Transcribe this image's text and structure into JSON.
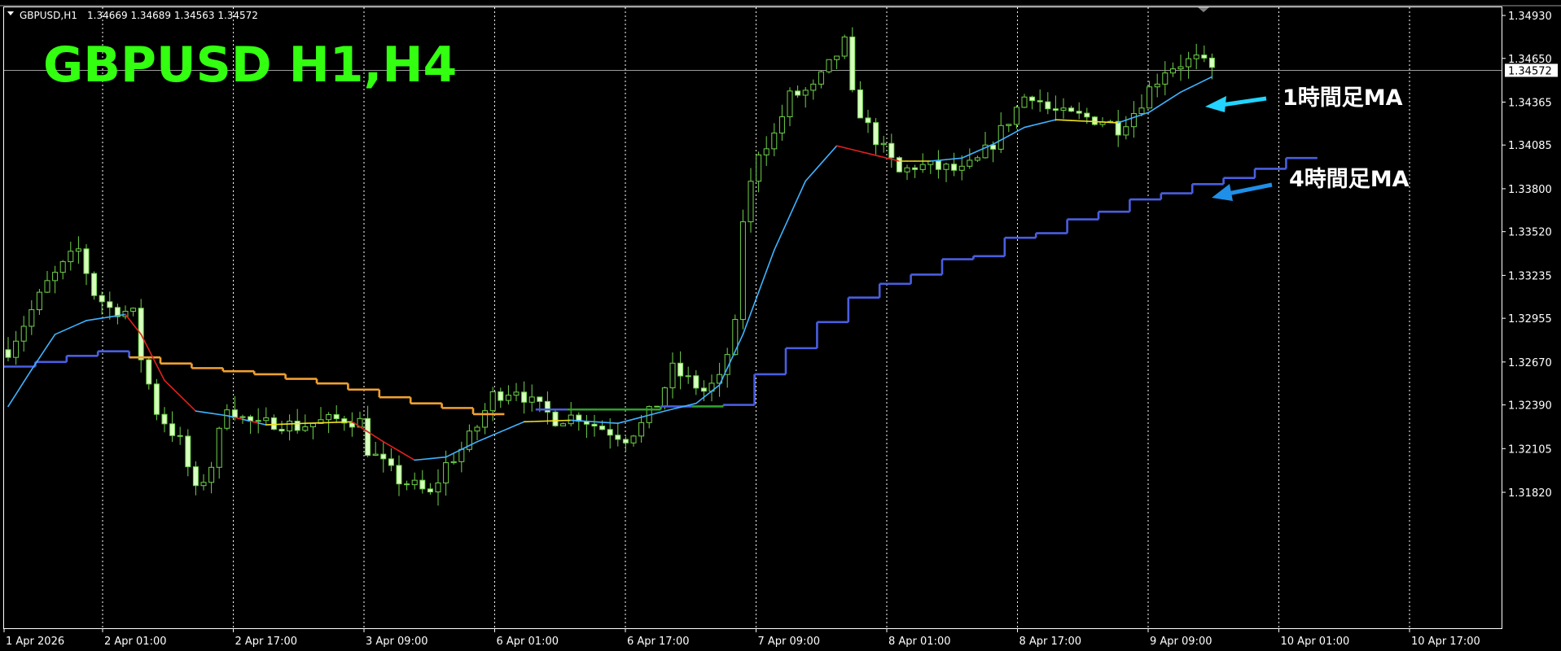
{
  "header": {
    "symbol_info": "GBPUSD,H1",
    "ohlc": "1.34669 1.34689 1.34563 1.34572"
  },
  "title": "GBPUSD  H1,H4",
  "current_price": "1.34572",
  "annotations": [
    {
      "label": "1時間足MA",
      "color": "#22d4ff"
    },
    {
      "label": "4時間足MA",
      "color": "#1f8fe8"
    }
  ],
  "colors": {
    "background": "#000000",
    "grid": "#ffffff",
    "candle": "#6fd24a",
    "candle_body_up": "#d8ffc0",
    "ma_h1": "#3fb3ff",
    "ma_h1_down": "#e02020",
    "ma_h1_flat": "#f0e020",
    "ma_h4": "#4a5ee0",
    "ma_h4_down": "#f0a030",
    "ma_h4_flat": "#30a030",
    "title": "#33ff11"
  },
  "chart_data": {
    "type": "candlestick",
    "title": "GBPUSD  H1,H4",
    "x_ticks": [
      "1 Apr 2026",
      "2 Apr 01:00",
      "2 Apr 17:00",
      "3 Apr 09:00",
      "6 Apr 01:00",
      "6 Apr 17:00",
      "7 Apr 09:00",
      "8 Apr 01:00",
      "8 Apr 17:00",
      "9 Apr 09:00",
      "10 Apr 01:00",
      "10 Apr 17:00"
    ],
    "y_ticks": [
      "1.34930",
      "1.34650",
      "1.34365",
      "1.34085",
      "1.33800",
      "1.33520",
      "1.33235",
      "1.32955",
      "1.32670",
      "1.32390",
      "1.32105",
      "1.31820"
    ],
    "ylim": [
      1.3168,
      1.3498
    ],
    "n_bars": 155,
    "close_anchors": [
      [
        0,
        1.3275
      ],
      [
        2,
        1.3292
      ],
      [
        5,
        1.3318
      ],
      [
        8,
        1.3335
      ],
      [
        9,
        1.334
      ],
      [
        11,
        1.3312
      ],
      [
        13,
        1.3302
      ],
      [
        15,
        1.33
      ],
      [
        16,
        1.3298
      ],
      [
        17,
        1.327
      ],
      [
        19,
        1.3235
      ],
      [
        22,
        1.3215
      ],
      [
        24,
        1.3182
      ],
      [
        26,
        1.32
      ],
      [
        28,
        1.324
      ],
      [
        30,
        1.323
      ],
      [
        32,
        1.3225
      ],
      [
        34,
        1.3228
      ],
      [
        37,
        1.3225
      ],
      [
        40,
        1.3228
      ],
      [
        43,
        1.323
      ],
      [
        45,
        1.3228
      ],
      [
        46,
        1.321
      ],
      [
        48,
        1.32
      ],
      [
        50,
        1.319
      ],
      [
        52,
        1.3186
      ],
      [
        54,
        1.318
      ],
      [
        56,
        1.32
      ],
      [
        58,
        1.321
      ],
      [
        60,
        1.3225
      ],
      [
        62,
        1.3245
      ],
      [
        65,
        1.325
      ],
      [
        67,
        1.324
      ],
      [
        70,
        1.323
      ],
      [
        73,
        1.3232
      ],
      [
        75,
        1.3226
      ],
      [
        77,
        1.3222
      ],
      [
        79,
        1.3218
      ],
      [
        81,
        1.3226
      ],
      [
        83,
        1.324
      ],
      [
        85,
        1.3262
      ],
      [
        87,
        1.3255
      ],
      [
        89,
        1.3248
      ],
      [
        91,
        1.3255
      ],
      [
        93,
        1.329
      ],
      [
        94,
        1.336
      ],
      [
        96,
        1.3405
      ],
      [
        98,
        1.3415
      ],
      [
        100,
        1.344
      ],
      [
        103,
        1.3445
      ],
      [
        105,
        1.346
      ],
      [
        107,
        1.3475
      ],
      [
        108,
        1.344
      ],
      [
        110,
        1.342
      ],
      [
        112,
        1.3405
      ],
      [
        114,
        1.339
      ],
      [
        116,
        1.3395
      ],
      [
        118,
        1.3394
      ],
      [
        120,
        1.3393
      ],
      [
        122,
        1.3391
      ],
      [
        124,
        1.3398
      ],
      [
        126,
        1.341
      ],
      [
        128,
        1.3425
      ],
      [
        130,
        1.344
      ],
      [
        131,
        1.3442
      ],
      [
        133,
        1.3432
      ],
      [
        135,
        1.3428
      ],
      [
        137,
        1.3427
      ],
      [
        140,
        1.3425
      ],
      [
        142,
        1.342
      ],
      [
        144,
        1.343
      ],
      [
        146,
        1.3445
      ],
      [
        148,
        1.3458
      ],
      [
        150,
        1.3462
      ],
      [
        152,
        1.3464
      ],
      [
        154,
        1.3457
      ]
    ],
    "ma_h1_anchors": [
      [
        0,
        1.3238
      ],
      [
        3,
        1.3262
      ],
      [
        6,
        1.3285
      ],
      [
        10,
        1.3294
      ],
      [
        15,
        1.3298
      ],
      [
        17,
        1.3285
      ],
      [
        20,
        1.3255
      ],
      [
        24,
        1.3235
      ],
      [
        28,
        1.3232
      ],
      [
        33,
        1.3226
      ],
      [
        38,
        1.3227
      ],
      [
        44,
        1.3228
      ],
      [
        48,
        1.3215
      ],
      [
        52,
        1.3203
      ],
      [
        56,
        1.3205
      ],
      [
        60,
        1.3215
      ],
      [
        66,
        1.3228
      ],
      [
        72,
        1.3229
      ],
      [
        78,
        1.3227
      ],
      [
        84,
        1.3235
      ],
      [
        88,
        1.324
      ],
      [
        91,
        1.3252
      ],
      [
        94,
        1.3285
      ],
      [
        98,
        1.334
      ],
      [
        102,
        1.3385
      ],
      [
        106,
        1.3408
      ],
      [
        110,
        1.3403
      ],
      [
        114,
        1.3398
      ],
      [
        118,
        1.3398
      ],
      [
        122,
        1.34
      ],
      [
        126,
        1.3409
      ],
      [
        130,
        1.342
      ],
      [
        134,
        1.3425
      ],
      [
        138,
        1.3424
      ],
      [
        142,
        1.3423
      ],
      [
        146,
        1.343
      ],
      [
        150,
        1.3443
      ],
      [
        154,
        1.3453
      ]
    ],
    "ma_h4_steps": [
      1.3264,
      1.3267,
      1.3271,
      1.3274,
      1.327,
      1.3266,
      1.3263,
      1.3261,
      1.3259,
      1.3256,
      1.3253,
      1.3249,
      1.3244,
      1.324,
      1.3237,
      1.3233,
      1.3231,
      1.3236,
      1.3236,
      1.3236,
      1.3236,
      1.3238,
      1.3238,
      1.3239,
      1.3259,
      1.3276,
      1.3293,
      1.3309,
      1.3318,
      1.3324,
      1.3334,
      1.3336,
      1.3348,
      1.3351,
      1.336,
      1.3365,
      1.3373,
      1.3377,
      1.3383,
      1.3387,
      1.3393,
      1.34
    ],
    "ma_h4_step_width": 4,
    "ma_h4_gap_after_step": 16
  }
}
